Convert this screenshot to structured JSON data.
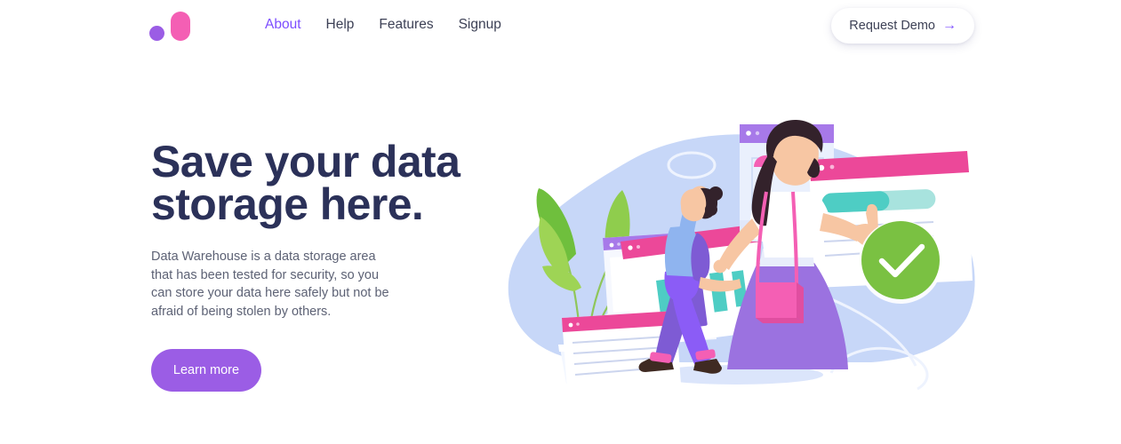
{
  "header": {
    "logo": {
      "name": "brand-logo",
      "dot_color": "#9b5de5",
      "pill_color": "#f45fb4"
    },
    "nav": [
      {
        "label": "About",
        "active": true
      },
      {
        "label": "Help",
        "active": false
      },
      {
        "label": "Features",
        "active": false
      },
      {
        "label": "Signup",
        "active": false
      }
    ],
    "cta": {
      "label": "Request Demo",
      "arrow": "→",
      "arrow_color": "#7c4dff"
    }
  },
  "hero": {
    "headline_line1": "Save your data",
    "headline_line2": "storage here.",
    "headline_color": "#2b3159",
    "paragraph": "Data Warehouse is a data storage area that has been tested for security, so you can store your data here safely but not be afraid of being stolen by others.",
    "button_label": "Learn more",
    "button_color": "#9b5de5"
  },
  "illustration": {
    "name": "data-storage-illustration",
    "alt": "Two people arranging dashboard window cards beside a potted plant with a green checkmark badge",
    "palette": {
      "blob_blue": "#c6d6f7",
      "card_white": "#ffffff",
      "card_shade": "#eaeefb",
      "header_pink": "#ec4899",
      "header_pink_light": "#f06cb4",
      "header_purple": "#a779e9",
      "teal": "#4ecdc4",
      "teal_light": "#a8e3de",
      "green_badge": "#7ac142",
      "skirt_purple": "#9b72e0",
      "pants_purple": "#8b5cf6",
      "bag_pink": "#f45fb4",
      "skin": "#f7c6a3",
      "hair_dark": "#33222b",
      "leaf_green": "#7dc242",
      "leaf_green_light": "#9ed455",
      "shoe_brown": "#3f2a22",
      "sock_pink": "#f45fb4",
      "shirt_blue": "#8fb4ef",
      "shirt_white": "#ffffff"
    },
    "elements": [
      {
        "name": "background-blob",
        "kind": "shape"
      },
      {
        "name": "potted-plant",
        "kind": "decor"
      },
      {
        "name": "window-card-pink-left",
        "kind": "card"
      },
      {
        "name": "window-card-purple-left",
        "kind": "card"
      },
      {
        "name": "window-card-pink-bars",
        "kind": "card"
      },
      {
        "name": "window-card-purple-chart",
        "kind": "card"
      },
      {
        "name": "window-card-pink-progress",
        "kind": "card"
      },
      {
        "name": "person-walking-left",
        "kind": "figure"
      },
      {
        "name": "person-woman-right",
        "kind": "figure"
      },
      {
        "name": "green-check-badge",
        "kind": "badge"
      }
    ]
  }
}
